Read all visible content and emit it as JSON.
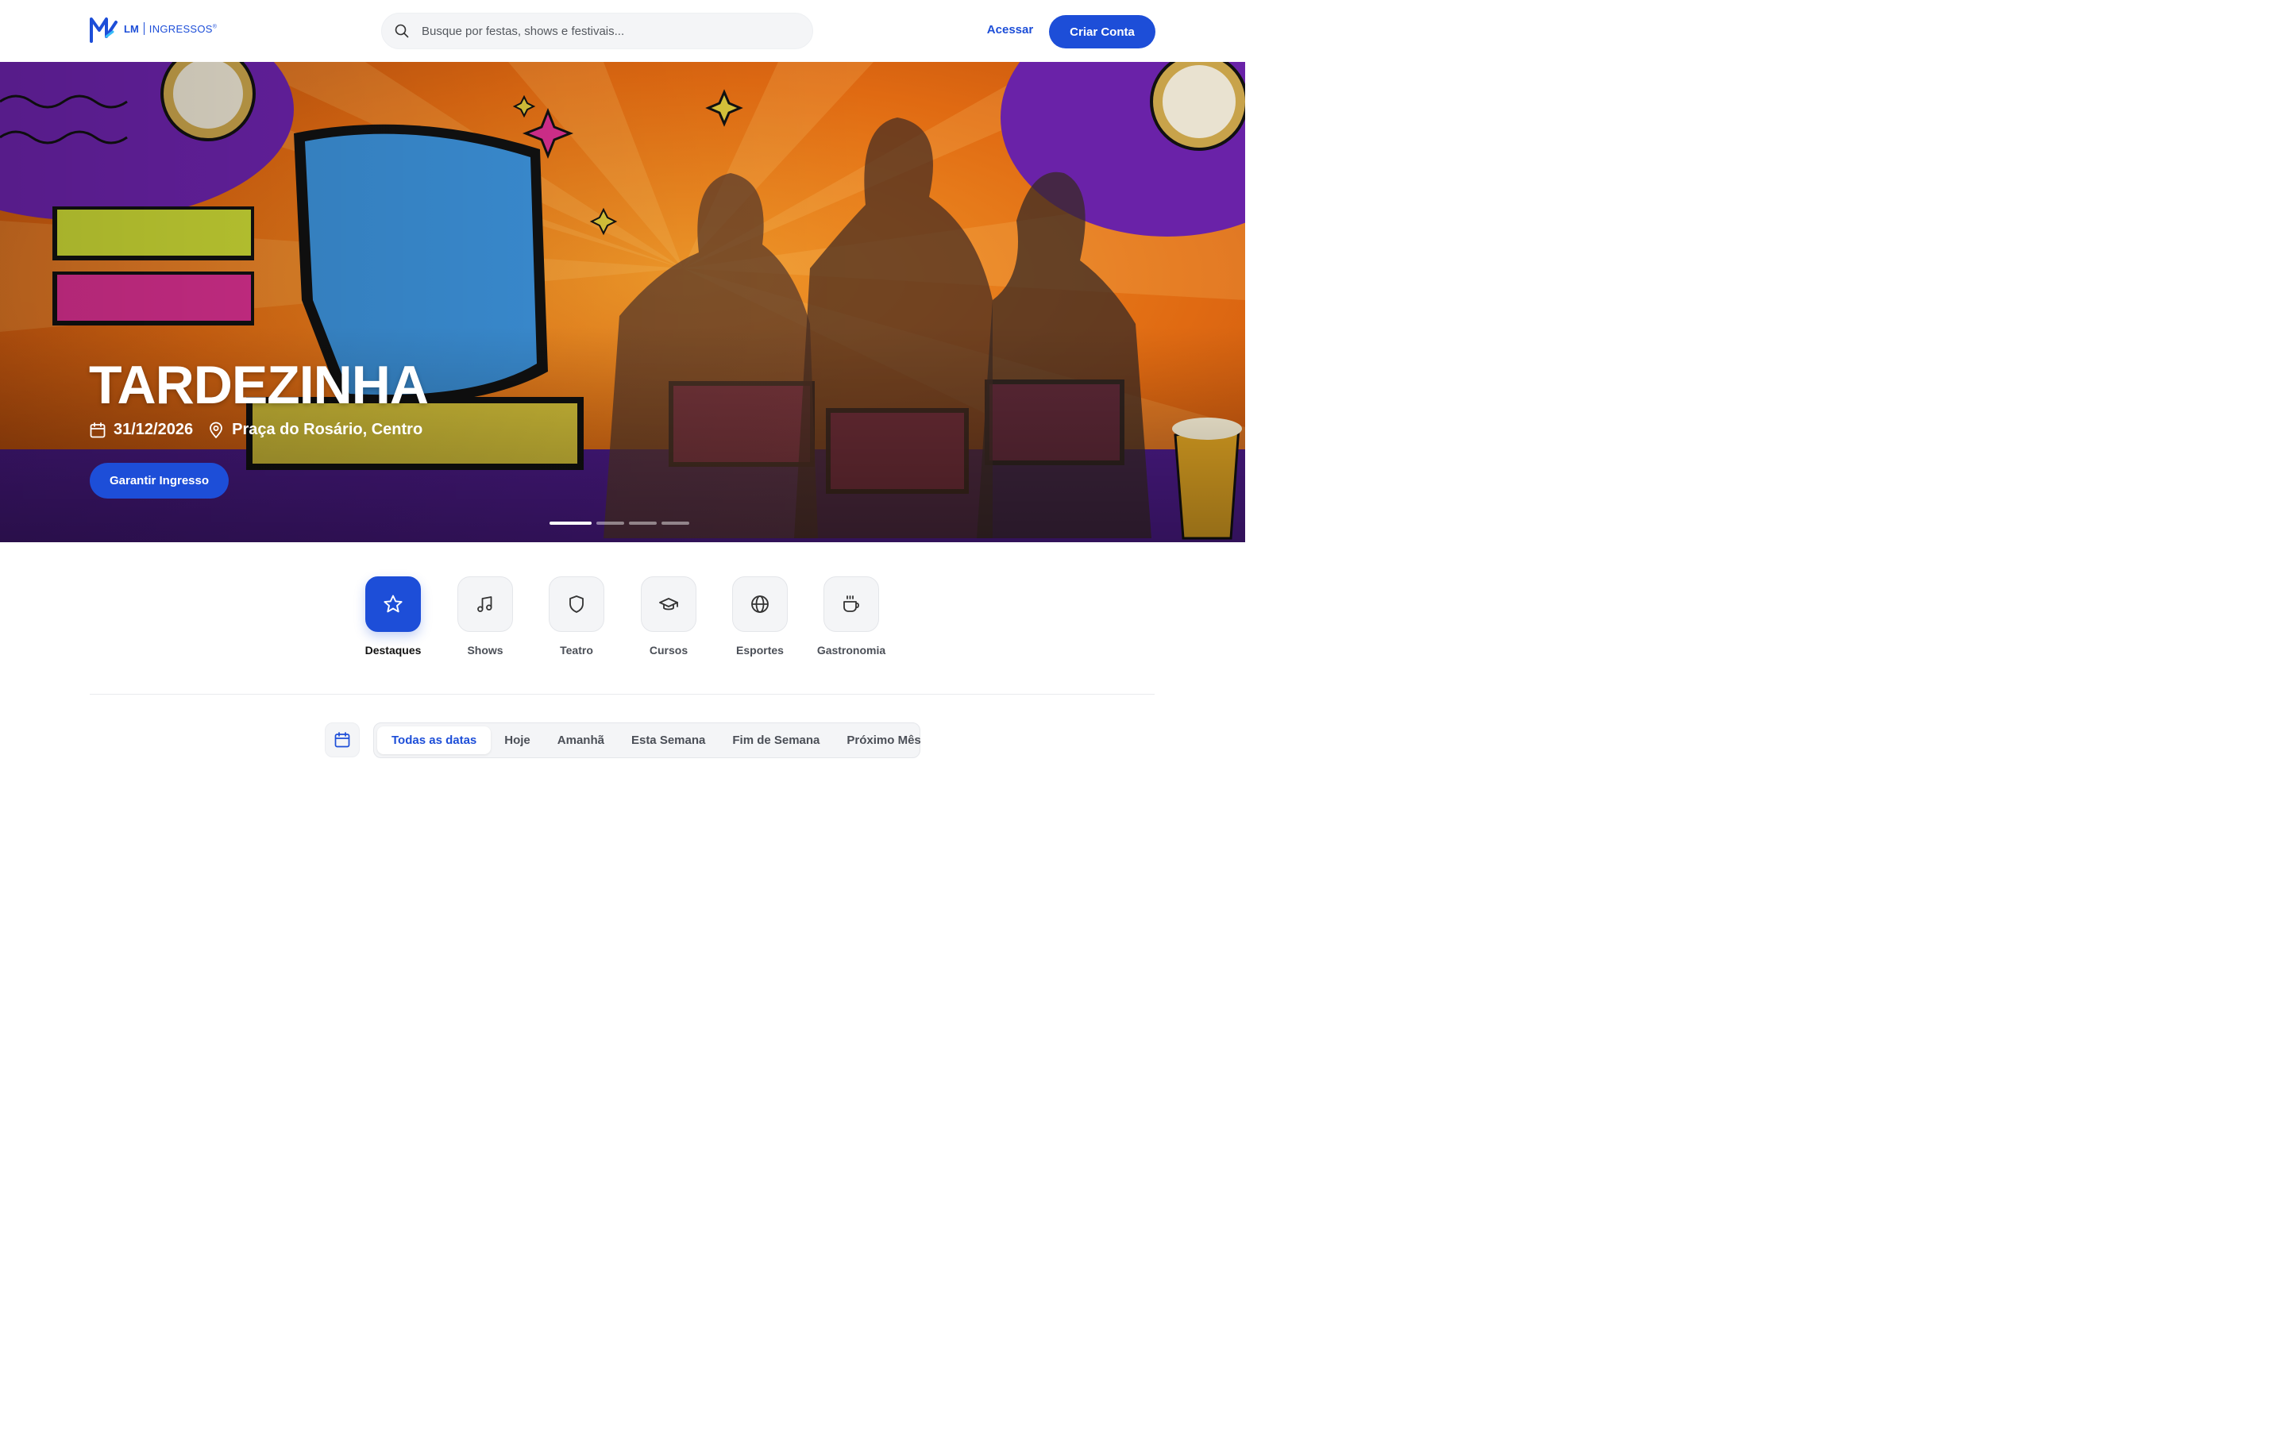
{
  "brand": {
    "short": "LM",
    "name": "INGRESSOS",
    "reg": "®"
  },
  "search": {
    "placeholder": "Busque por festas, shows e festivais...",
    "icon": "search-icon"
  },
  "header": {
    "login_label": "Acessar",
    "signup_label": "Criar Conta"
  },
  "hero": {
    "title": "TARDEZINHA",
    "date": "31/12/2026",
    "location": "Praça do Rosário, Centro",
    "cta_label": "Garantir Ingresso",
    "slides_total": 4,
    "slide_active": 1
  },
  "categories": [
    {
      "label": "Destaques",
      "icon": "star-icon",
      "active": true
    },
    {
      "label": "Shows",
      "icon": "music-note-icon",
      "active": false
    },
    {
      "label": "Teatro",
      "icon": "shield-icon",
      "active": false
    },
    {
      "label": "Cursos",
      "icon": "graduation-cap-icon",
      "active": false
    },
    {
      "label": "Esportes",
      "icon": "globe-icon",
      "active": false
    },
    {
      "label": "Gastronomia",
      "icon": "coffee-cup-icon",
      "active": false
    }
  ],
  "date_filter": {
    "icon": "calendar-icon",
    "tabs": [
      "Todas as datas",
      "Hoje",
      "Amanhã",
      "Esta Semana",
      "Fim de Semana",
      "Próximo Mês"
    ],
    "active_index": 0
  },
  "colors": {
    "primary": "#1d4ed8",
    "hero_orange": "#e06a12",
    "hero_purple": "#6a22a8"
  }
}
